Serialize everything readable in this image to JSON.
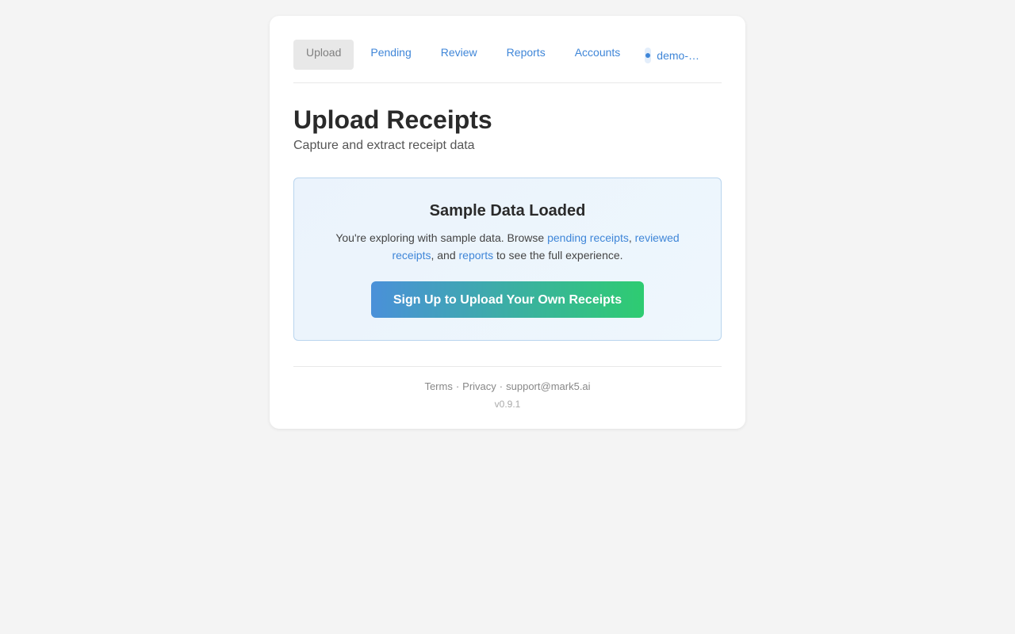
{
  "nav": {
    "tabs": [
      {
        "label": "Upload",
        "active": true
      },
      {
        "label": "Pending",
        "active": false
      },
      {
        "label": "Review",
        "active": false
      },
      {
        "label": "Reports",
        "active": false
      },
      {
        "label": "Accounts",
        "active": false
      }
    ],
    "user_label": "demo-…"
  },
  "page": {
    "title": "Upload Receipts",
    "subtitle": "Capture and extract receipt data"
  },
  "banner": {
    "heading": "Sample Data Loaded",
    "text_prefix": "You're exploring with sample data. Browse ",
    "link_pending": "pending receipts",
    "sep1": ", ",
    "link_reviewed": "reviewed receipts",
    "sep2": ", and ",
    "link_reports": "reports",
    "text_suffix": " to see the full experience.",
    "cta_label": "Sign Up to Upload Your Own Receipts"
  },
  "footer": {
    "terms": "Terms",
    "privacy": "Privacy",
    "support": "support@mark5.ai",
    "separator": "·",
    "version": "v0.9.1"
  },
  "colors": {
    "accent": "#3f86d8",
    "cta_gradient_start": "#4a90d9",
    "cta_gradient_end": "#2ecc71",
    "page_bg": "#f4f4f4"
  }
}
